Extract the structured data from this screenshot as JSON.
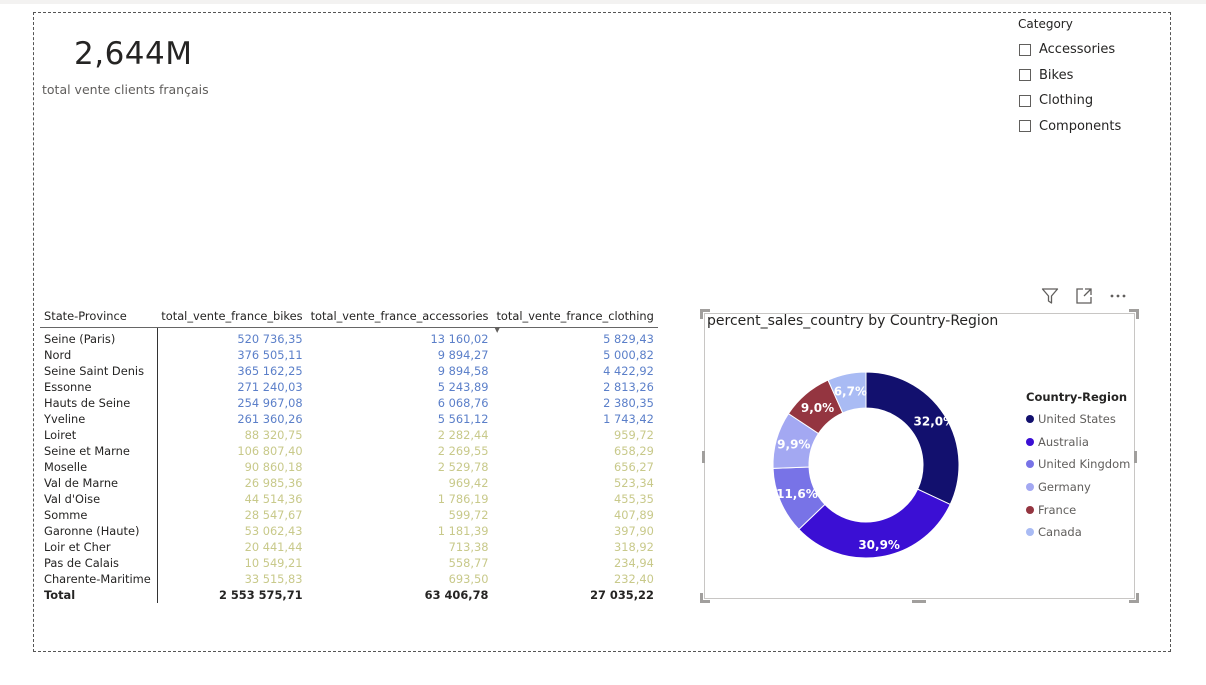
{
  "kpi": {
    "value": "2,644M",
    "label": "total vente clients français"
  },
  "slicer": {
    "title": "Category",
    "items": [
      "Accessories",
      "Bikes",
      "Clothing",
      "Components"
    ]
  },
  "table": {
    "columns": [
      "State-Province",
      "total_vente_france_bikes",
      "total_vente_france_accessories",
      "total_vente_france_clothing"
    ],
    "sorted_column": "total_vente_france_clothing",
    "rows": [
      {
        "name": "Seine (Paris)",
        "bikes": "520 736,35",
        "accessories": "13 160,02",
        "clothing": "5 829,43"
      },
      {
        "name": "Nord",
        "bikes": "376 505,11",
        "accessories": "9 894,27",
        "clothing": "5 000,82"
      },
      {
        "name": "Seine Saint Denis",
        "bikes": "365 162,25",
        "accessories": "9 894,58",
        "clothing": "4 422,92"
      },
      {
        "name": "Essonne",
        "bikes": "271 240,03",
        "accessories": "5 243,89",
        "clothing": "2 813,26"
      },
      {
        "name": "Hauts de Seine",
        "bikes": "254 967,08",
        "accessories": "6 068,76",
        "clothing": "2 380,35"
      },
      {
        "name": "Yveline",
        "bikes": "261 360,26",
        "accessories": "5 561,12",
        "clothing": "1 743,42"
      },
      {
        "name": "Loiret",
        "bikes": "88 320,75",
        "accessories": "2 282,44",
        "clothing": "959,72"
      },
      {
        "name": "Seine et Marne",
        "bikes": "106 807,40",
        "accessories": "2 269,55",
        "clothing": "658,29"
      },
      {
        "name": "Moselle",
        "bikes": "90 860,18",
        "accessories": "2 529,78",
        "clothing": "656,27"
      },
      {
        "name": "Val de Marne",
        "bikes": "26 985,36",
        "accessories": "969,42",
        "clothing": "523,34"
      },
      {
        "name": "Val d'Oise",
        "bikes": "44 514,36",
        "accessories": "1 786,19",
        "clothing": "455,35"
      },
      {
        "name": "Somme",
        "bikes": "28 547,67",
        "accessories": "599,72",
        "clothing": "407,89"
      },
      {
        "name": "Garonne (Haute)",
        "bikes": "53 062,43",
        "accessories": "1 181,39",
        "clothing": "397,90"
      },
      {
        "name": "Loir et Cher",
        "bikes": "20 441,44",
        "accessories": "713,38",
        "clothing": "318,92"
      },
      {
        "name": "Pas de Calais",
        "bikes": "10 549,21",
        "accessories": "558,77",
        "clothing": "234,94"
      },
      {
        "name": "Charente-Maritime",
        "bikes": "33 515,83",
        "accessories": "693,50",
        "clothing": "232,40"
      }
    ],
    "total": {
      "name": "Total",
      "bikes": "2 553 575,71",
      "accessories": "63 406,78",
      "clothing": "27 035,22"
    },
    "colors": {
      "high": "#5b7fc9",
      "low": "#c8c98a"
    },
    "highlighted_rows": 6
  },
  "chart_data": {
    "type": "pie",
    "variant": "donut",
    "title": "percent_sales_country by Country-Region",
    "legend_title": "Country-Region",
    "legend_position": "right",
    "categories": [
      "United States",
      "Australia",
      "United Kingdom",
      "Germany",
      "France",
      "Canada"
    ],
    "values": [
      32.0,
      30.9,
      11.6,
      9.9,
      9.0,
      6.7
    ],
    "labels": [
      "32,0%",
      "30,9%",
      "11,6%",
      "9,9%",
      "9,0%",
      "6,7%"
    ],
    "colors": [
      "#12106e",
      "#3b0fd4",
      "#7873e7",
      "#a3a8f2",
      "#943540",
      "#a9bbf4"
    ]
  }
}
